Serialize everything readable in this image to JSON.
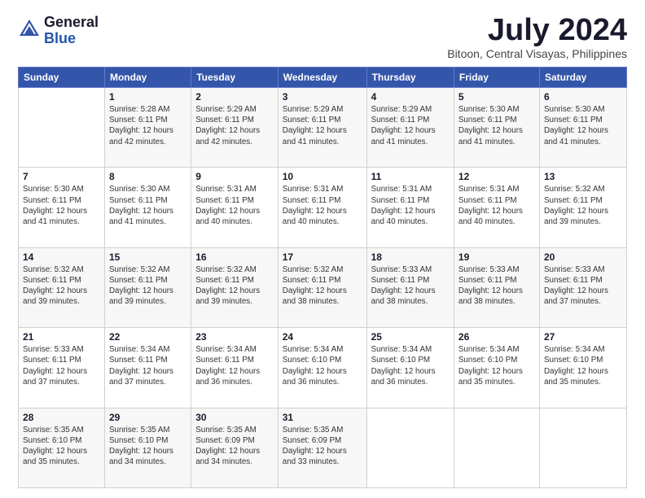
{
  "logo": {
    "general": "General",
    "blue": "Blue"
  },
  "title": "July 2024",
  "location": "Bitoon, Central Visayas, Philippines",
  "weekdays": [
    "Sunday",
    "Monday",
    "Tuesday",
    "Wednesday",
    "Thursday",
    "Friday",
    "Saturday"
  ],
  "weeks": [
    [
      {
        "day": "",
        "info": ""
      },
      {
        "day": "1",
        "info": "Sunrise: 5:28 AM\nSunset: 6:11 PM\nDaylight: 12 hours and 42 minutes."
      },
      {
        "day": "2",
        "info": "Sunrise: 5:29 AM\nSunset: 6:11 PM\nDaylight: 12 hours and 42 minutes."
      },
      {
        "day": "3",
        "info": "Sunrise: 5:29 AM\nSunset: 6:11 PM\nDaylight: 12 hours and 41 minutes."
      },
      {
        "day": "4",
        "info": "Sunrise: 5:29 AM\nSunset: 6:11 PM\nDaylight: 12 hours and 41 minutes."
      },
      {
        "day": "5",
        "info": "Sunrise: 5:30 AM\nSunset: 6:11 PM\nDaylight: 12 hours and 41 minutes."
      },
      {
        "day": "6",
        "info": "Sunrise: 5:30 AM\nSunset: 6:11 PM\nDaylight: 12 hours and 41 minutes."
      }
    ],
    [
      {
        "day": "7",
        "info": ""
      },
      {
        "day": "8",
        "info": "Sunrise: 5:30 AM\nSunset: 6:11 PM\nDaylight: 12 hours and 41 minutes."
      },
      {
        "day": "9",
        "info": "Sunrise: 5:31 AM\nSunset: 6:11 PM\nDaylight: 12 hours and 40 minutes."
      },
      {
        "day": "10",
        "info": "Sunrise: 5:31 AM\nSunset: 6:11 PM\nDaylight: 12 hours and 40 minutes."
      },
      {
        "day": "11",
        "info": "Sunrise: 5:31 AM\nSunset: 6:11 PM\nDaylight: 12 hours and 40 minutes."
      },
      {
        "day": "12",
        "info": "Sunrise: 5:31 AM\nSunset: 6:11 PM\nDaylight: 12 hours and 40 minutes."
      },
      {
        "day": "13",
        "info": "Sunrise: 5:32 AM\nSunset: 6:11 PM\nDaylight: 12 hours and 39 minutes."
      }
    ],
    [
      {
        "day": "14",
        "info": ""
      },
      {
        "day": "15",
        "info": "Sunrise: 5:32 AM\nSunset: 6:11 PM\nDaylight: 12 hours and 39 minutes."
      },
      {
        "day": "16",
        "info": "Sunrise: 5:32 AM\nSunset: 6:11 PM\nDaylight: 12 hours and 39 minutes."
      },
      {
        "day": "17",
        "info": "Sunrise: 5:32 AM\nSunset: 6:11 PM\nDaylight: 12 hours and 38 minutes."
      },
      {
        "day": "18",
        "info": "Sunrise: 5:33 AM\nSunset: 6:11 PM\nDaylight: 12 hours and 38 minutes."
      },
      {
        "day": "19",
        "info": "Sunrise: 5:33 AM\nSunset: 6:11 PM\nDaylight: 12 hours and 38 minutes."
      },
      {
        "day": "20",
        "info": "Sunrise: 5:33 AM\nSunset: 6:11 PM\nDaylight: 12 hours and 37 minutes."
      }
    ],
    [
      {
        "day": "21",
        "info": ""
      },
      {
        "day": "22",
        "info": "Sunrise: 5:34 AM\nSunset: 6:11 PM\nDaylight: 12 hours and 37 minutes."
      },
      {
        "day": "23",
        "info": "Sunrise: 5:34 AM\nSunset: 6:11 PM\nDaylight: 12 hours and 36 minutes."
      },
      {
        "day": "24",
        "info": "Sunrise: 5:34 AM\nSunset: 6:10 PM\nDaylight: 12 hours and 36 minutes."
      },
      {
        "day": "25",
        "info": "Sunrise: 5:34 AM\nSunset: 6:10 PM\nDaylight: 12 hours and 36 minutes."
      },
      {
        "day": "26",
        "info": "Sunrise: 5:34 AM\nSunset: 6:10 PM\nDaylight: 12 hours and 35 minutes."
      },
      {
        "day": "27",
        "info": "Sunrise: 5:34 AM\nSunset: 6:10 PM\nDaylight: 12 hours and 35 minutes."
      }
    ],
    [
      {
        "day": "28",
        "info": "Sunrise: 5:35 AM\nSunset: 6:10 PM\nDaylight: 12 hours and 35 minutes."
      },
      {
        "day": "29",
        "info": "Sunrise: 5:35 AM\nSunset: 6:10 PM\nDaylight: 12 hours and 34 minutes."
      },
      {
        "day": "30",
        "info": "Sunrise: 5:35 AM\nSunset: 6:09 PM\nDaylight: 12 hours and 34 minutes."
      },
      {
        "day": "31",
        "info": "Sunrise: 5:35 AM\nSunset: 6:09 PM\nDaylight: 12 hours and 33 minutes."
      },
      {
        "day": "",
        "info": ""
      },
      {
        "day": "",
        "info": ""
      },
      {
        "day": "",
        "info": ""
      }
    ]
  ],
  "week7_sunday": "Sunrise: 5:30 AM\nSunset: 6:11 PM\nDaylight: 12 hours and 41 minutes.",
  "week14_sunday": "Sunrise: 5:32 AM\nSunset: 6:11 PM\nDaylight: 12 hours and 39 minutes.",
  "week21_sunday": "Sunrise: 5:33 AM\nSunset: 6:11 PM\nDaylight: 12 hours and 37 minutes."
}
